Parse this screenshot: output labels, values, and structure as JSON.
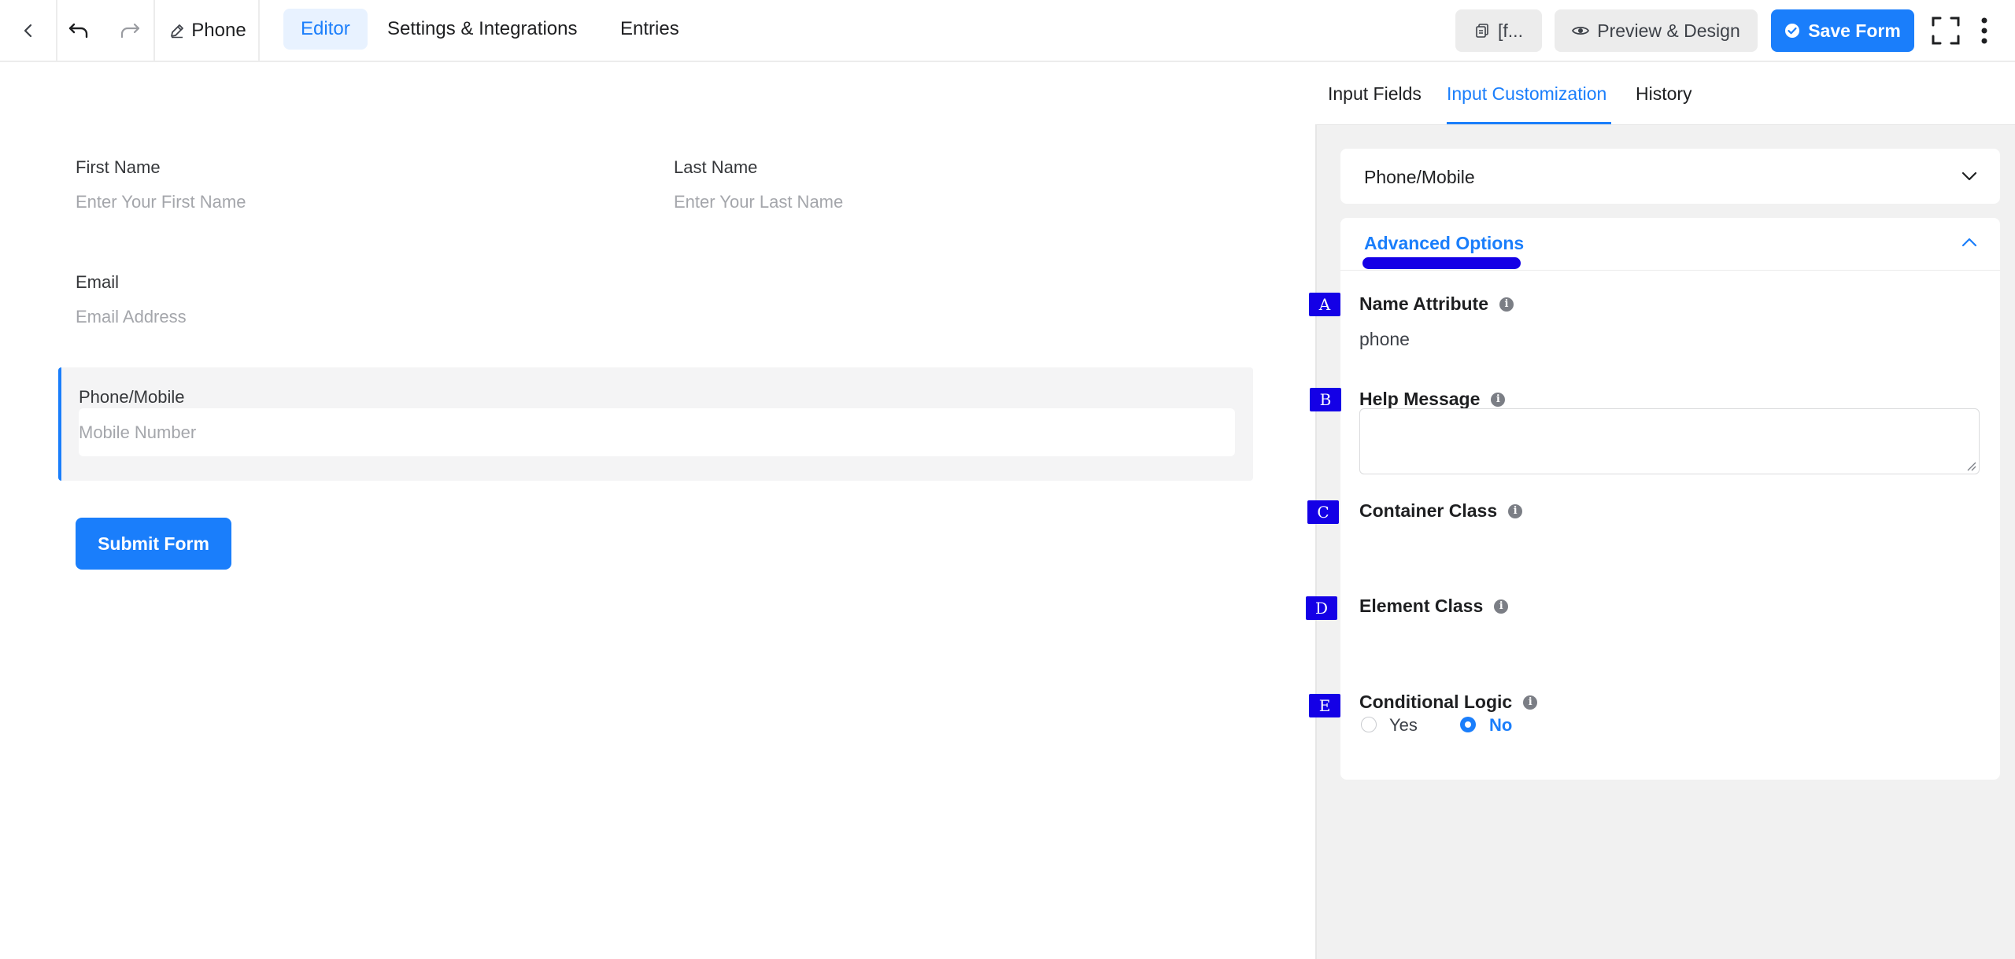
{
  "topbar": {
    "form_title": "Phone",
    "tabs": [
      {
        "label": "Editor",
        "active": true
      },
      {
        "label": "Settings & Integrations",
        "active": false
      },
      {
        "label": "Entries",
        "active": false
      }
    ],
    "shortcode_label": "[f...",
    "preview_label": "Preview & Design",
    "save_label": "Save Form"
  },
  "form": {
    "first_name": {
      "label": "First Name",
      "placeholder": "Enter Your First Name"
    },
    "last_name": {
      "label": "Last Name",
      "placeholder": "Enter Your Last Name"
    },
    "email": {
      "label": "Email",
      "placeholder": "Email Address"
    },
    "phone": {
      "label": "Phone/Mobile",
      "placeholder": "Mobile Number"
    },
    "submit_label": "Submit Form"
  },
  "panel": {
    "tabs": [
      {
        "label": "Input Fields",
        "active": false
      },
      {
        "label": "Input Customization",
        "active": true
      },
      {
        "label": "History",
        "active": false
      }
    ],
    "field_type": "Phone/Mobile",
    "advanced_title": "Advanced Options",
    "settings": [
      {
        "marker": "A",
        "label": "Name Attribute",
        "value": "phone"
      },
      {
        "marker": "B",
        "label": "Help Message",
        "value": ""
      },
      {
        "marker": "C",
        "label": "Container Class",
        "value": ""
      },
      {
        "marker": "D",
        "label": "Element Class",
        "value": ""
      },
      {
        "marker": "E",
        "label": "Conditional Logic",
        "value": "No"
      }
    ],
    "conditional_options": [
      "Yes",
      "No"
    ]
  },
  "colors": {
    "accent": "#1a7efb",
    "marker": "#1400e6",
    "highlight": "#1400e6"
  }
}
